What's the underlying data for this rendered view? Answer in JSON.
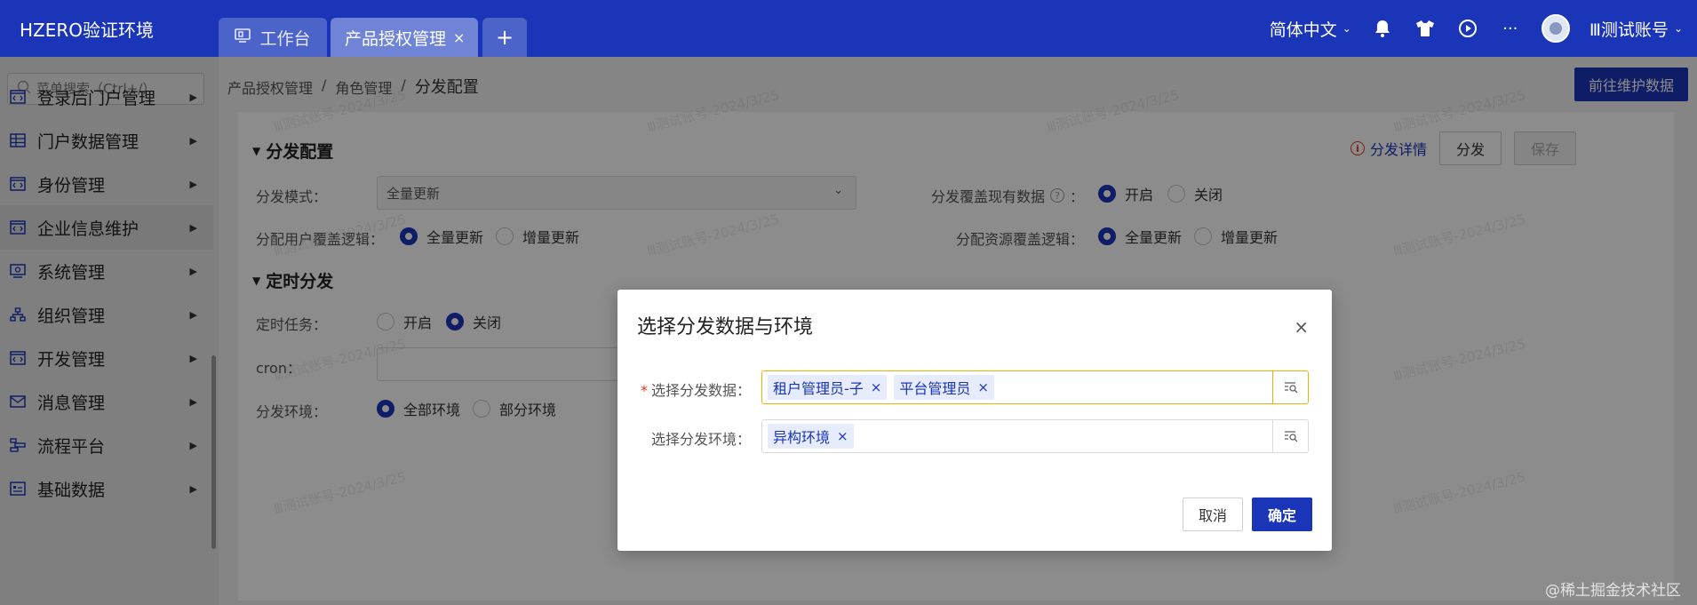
{
  "header": {
    "brand": "HZERO验证环境",
    "tabs": [
      {
        "label": "工作台"
      },
      {
        "label": "产品授权管理",
        "close": "×"
      }
    ],
    "add_tab": "+",
    "language": "简体中文",
    "user": "Ⅲ测试账号",
    "more": "···"
  },
  "sidebar": {
    "search_placeholder": "菜单搜索（Ctrl+/）",
    "items": [
      {
        "label": "登录后门户管理",
        "icon": "code-window-icon"
      },
      {
        "label": "门户数据管理",
        "icon": "table-icon"
      },
      {
        "label": "身份管理",
        "icon": "code-window-icon"
      },
      {
        "label": "企业信息维护",
        "icon": "code-window-icon"
      },
      {
        "label": "系统管理",
        "icon": "settings-window-icon"
      },
      {
        "label": "组织管理",
        "icon": "org-tree-icon"
      },
      {
        "label": "开发管理",
        "icon": "code-window-icon"
      },
      {
        "label": "消息管理",
        "icon": "mail-icon"
      },
      {
        "label": "流程平台",
        "icon": "flow-icon"
      },
      {
        "label": "基础数据",
        "icon": "data-icon"
      }
    ],
    "arrow": "▶"
  },
  "breadcrumb": {
    "items": [
      "产品授权管理",
      "角色管理"
    ],
    "separator": "/",
    "current": "分发配置"
  },
  "goto_button": "前往维护数据",
  "panel": {
    "actions": {
      "detail": "分发详情",
      "distribute": "分发",
      "save": "保存"
    },
    "section1": {
      "title": "分发配置",
      "mode_label": "分发模式：",
      "mode_value": "全量更新",
      "cover_label": "分发覆盖现有数据",
      "cover_help": "?",
      "cover_on": "开启",
      "cover_off": "关闭",
      "user_label": "分配用户覆盖逻辑：",
      "user_opt1": "全量更新",
      "user_opt2": "增量更新",
      "res_label": "分配资源覆盖逻辑：",
      "res_opt1": "全量更新",
      "res_opt2": "增量更新"
    },
    "section2": {
      "title": "定时分发",
      "task_label": "定时任务：",
      "task_on": "开启",
      "task_off": "关闭",
      "cron_label": "cron：",
      "env_label": "分发环境：",
      "env_all": "全部环境",
      "env_part": "部分环境"
    }
  },
  "watermark": "Ⅲ测试账号-2024/3/25",
  "modal": {
    "title": "选择分发数据与环境",
    "close": "×",
    "data_label": "选择分发数据：",
    "required_mark": "*",
    "data_tags": [
      "租户管理员-子",
      "平台管理员"
    ],
    "env_label": "选择分发环境：",
    "env_tags": [
      "异构环境"
    ],
    "tag_close": "×",
    "cancel": "取消",
    "ok": "确定"
  },
  "footer_mark": "@稀土掘金技术社区",
  "colors": {
    "primary": "#1a35b8",
    "required": "#e0322b",
    "focus_border": "#f0b100"
  }
}
